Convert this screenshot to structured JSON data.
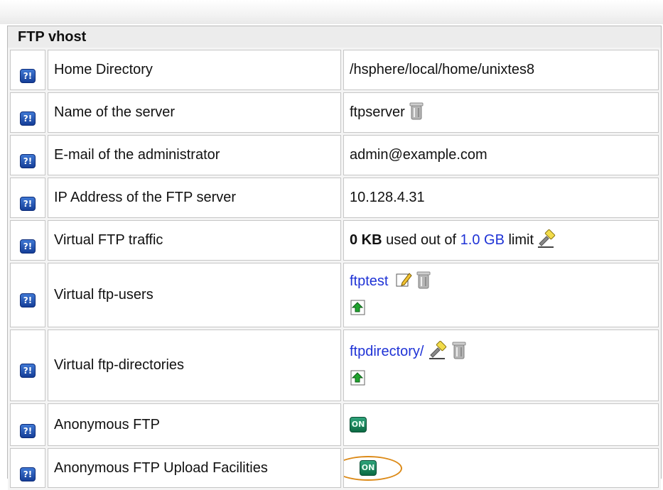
{
  "panel": {
    "title": "FTP vhost"
  },
  "help_glyph": "?!",
  "on_glyph": "ON",
  "rows": [
    {
      "label": "Home Directory",
      "value": "/hsphere/local/home/unixtes8"
    },
    {
      "label": "Name of the server",
      "value": "ftpserver",
      "icons": [
        "trash-icon"
      ]
    },
    {
      "label": "E-mail of the administrator",
      "value": "admin@example.com"
    },
    {
      "label": "IP Address of the FTP server",
      "value": "10.128.4.31"
    },
    {
      "label": "Virtual FTP traffic",
      "value_bold": "0 KB",
      "value_text1": " used out of ",
      "value_link": "1.0 GB",
      "value_text2": " limit",
      "icons": [
        "hammer-icon"
      ]
    },
    {
      "label": "Virtual ftp-users",
      "value_link": "ftptest",
      "icons": [
        "edit-icon",
        "trash-icon",
        "add-icon"
      ]
    },
    {
      "label": "Virtual ftp-directories",
      "value_link": "ftpdirectory/",
      "icons": [
        "hammer-icon",
        "trash-icon",
        "add-icon"
      ]
    },
    {
      "label": "Anonymous FTP",
      "status": "on",
      "icons": [
        "on-toggle-icon"
      ]
    },
    {
      "label": "Anonymous FTP Upload Facilities",
      "status": "on",
      "highlighted": true,
      "icons": [
        "on-toggle-icon"
      ]
    }
  ],
  "colors": {
    "link": "#1f33d6",
    "help_icon": "#1e50b8",
    "on_icon": "#1a8a5a",
    "highlight_ring": "#dc8a18"
  }
}
